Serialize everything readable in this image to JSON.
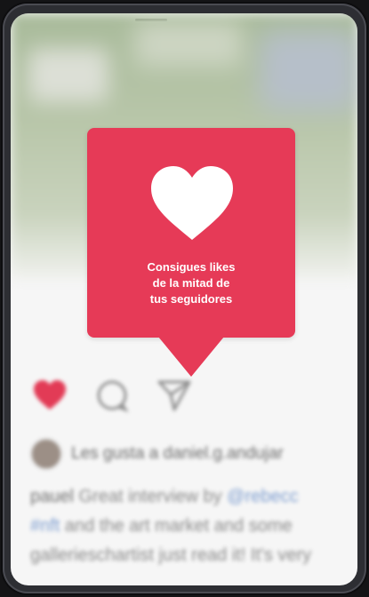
{
  "tooltip": {
    "lines": [
      "Consigues likes",
      "de la mitad de",
      "tus seguidores"
    ]
  },
  "post": {
    "likes_text": "Les gusta a daniel.g.andujar",
    "caption_lines": [
      {
        "user": "pauel",
        "text": " Great interview by ",
        "link": "@rebecc"
      },
      {
        "user": "",
        "text": "and the art market and some",
        "link": "#nft"
      },
      {
        "user": "",
        "text": "gallerieschartist just read it! It's very",
        "link": ""
      },
      {
        "user": "",
        "text": "",
        "link": ""
      }
    ]
  },
  "icons": [
    "heart-filled-icon",
    "comment-icon",
    "share-icon",
    "heart-icon"
  ],
  "colors": {
    "accent": "#e63a57",
    "link": "#7e9ed0",
    "frame": "#2d2e33"
  }
}
